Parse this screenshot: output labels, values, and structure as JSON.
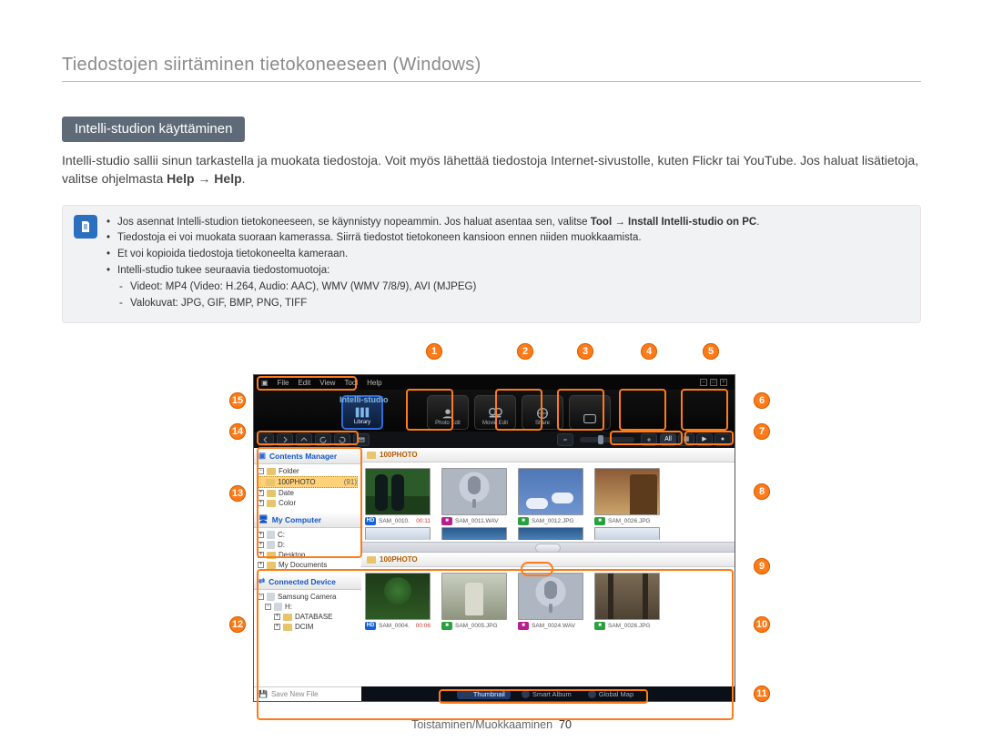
{
  "page": {
    "title": "Tiedostojen siirtäminen tietokoneeseen (Windows)",
    "section_title": "Intelli-studion käyttäminen",
    "intro_a": "Intelli-studio sallii sinun tarkastella ja muokata tiedostoja. Voit myös lähettää tiedostoja Internet-sivustolle, kuten Flickr tai YouTube. Jos haluat lisätietoja, valitse ohjelmasta ",
    "intro_b1": "Help",
    "intro_arrow": " → ",
    "intro_b2": "Help",
    "intro_c": ".",
    "footer_label": "Toistaminen/Muokkaaminen",
    "footer_page": "70"
  },
  "note": {
    "l1a": "Jos asennat Intelli-studion tietokoneeseen, se käynnistyy nopeammin. Jos haluat asentaa sen, valitse ",
    "l1b1": "Tool",
    "l1arrow": " → ",
    "l1b2": "Install Intelli-studio on PC",
    "l1c": ".",
    "l2": "Tiedostoja ei voi muokata suoraan kamerassa. Siirrä tiedostot tietokoneen kansioon ennen niiden muokkaamista.",
    "l3": "Et voi kopioida tiedostoja tietokoneelta kameraan.",
    "l4": "Intelli-studio tukee seuraavia tiedostomuotoja:",
    "l4a": "Videot: MP4 (Video: H.264, Audio: AAC), WMV (WMV 7/8/9), AVI (MJPEG)",
    "l4b": "Valokuvat: JPG, GIF, BMP, PNG, TIFF"
  },
  "app": {
    "brand": "Intelli-studio",
    "menu": {
      "file": "File",
      "edit": "Edit",
      "view": "View",
      "tool": "Tool",
      "help": "Help"
    },
    "modes": {
      "library": "Library",
      "photo": "Photo Edit",
      "movie": "Movie Edit",
      "share": "Share"
    },
    "filters": {
      "all": "All"
    },
    "sidebar": {
      "contents_manager": "Contents Manager",
      "folder": "Folder",
      "folder_100": "100PHOTO",
      "folder_100_count": "(91)",
      "date": "Date",
      "color": "Color",
      "my_computer": "My Computer",
      "drive_c": "C:",
      "drive_d": "D:",
      "desktop": "Desktop",
      "my_documents": "My Documents",
      "connected_device": "Connected Device",
      "camera": "Samsung Camera",
      "vol": "H:",
      "database": "DATABASE",
      "dcim": "DCIM",
      "save_new": "Save New File"
    },
    "content": {
      "section_label": "100PHOTO",
      "top": [
        {
          "badge": "HD",
          "bclass": "b-hd",
          "name": "SAM_0010.",
          "dur": "00:11",
          "img": "legs"
        },
        {
          "badge": "■",
          "bclass": "b-wav",
          "name": "SAM_0011.WAV",
          "dur": "",
          "img": "mic"
        },
        {
          "badge": "■",
          "bclass": "b-jpg",
          "name": "SAM_0012.JPG",
          "dur": "",
          "img": "clouds"
        },
        {
          "badge": "■",
          "bclass": "b-jpg",
          "name": "SAM_0026.JPG",
          "dur": "",
          "img": "rock"
        }
      ],
      "top2": [
        {
          "img": "snow"
        },
        {
          "img": "sea"
        },
        {
          "img": "sea"
        },
        {
          "img": "snow"
        }
      ],
      "bottom": [
        {
          "badge": "HD",
          "bclass": "b-hd",
          "name": "SAM_0004.",
          "dur": "00:06",
          "img": "tree"
        },
        {
          "badge": "■",
          "bclass": "b-jpg",
          "name": "SAM_0005.JPG",
          "dur": "",
          "img": "fount"
        },
        {
          "badge": "■",
          "bclass": "b-wav",
          "name": "SAM_0024.WAV",
          "dur": "",
          "img": "mic"
        },
        {
          "badge": "■",
          "bclass": "b-jpg",
          "name": "SAM_0026.JPG",
          "dur": "",
          "img": "rail"
        }
      ]
    },
    "viewbar": {
      "thumbnail": "Thumbnail",
      "smart": "Smart Album",
      "map": "Global Map"
    }
  },
  "callouts": [
    "1",
    "2",
    "3",
    "4",
    "5",
    "6",
    "7",
    "8",
    "9",
    "10",
    "11",
    "12",
    "13",
    "14",
    "15"
  ]
}
